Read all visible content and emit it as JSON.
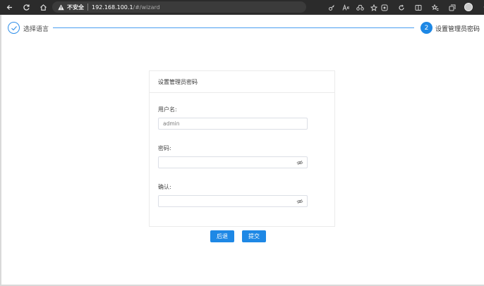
{
  "browser": {
    "insecure_label": "不安全",
    "url_host": "192.168.100.1",
    "url_path": "/#/wizard",
    "more_label": "···"
  },
  "steps": [
    {
      "label": "选择语言",
      "status": "done"
    },
    {
      "label": "设置管理员密码",
      "number": "2",
      "status": "active"
    }
  ],
  "card": {
    "title": "设置管理员密码"
  },
  "form": {
    "username_label": "用户名:",
    "username_value": "admin",
    "password_label": "密码:",
    "password_value": "",
    "confirm_label": "确认:",
    "confirm_value": ""
  },
  "buttons": {
    "back": "后退",
    "submit": "提交"
  },
  "colors": {
    "accent": "#1e88e5",
    "chrome": "#2b2b2b"
  }
}
